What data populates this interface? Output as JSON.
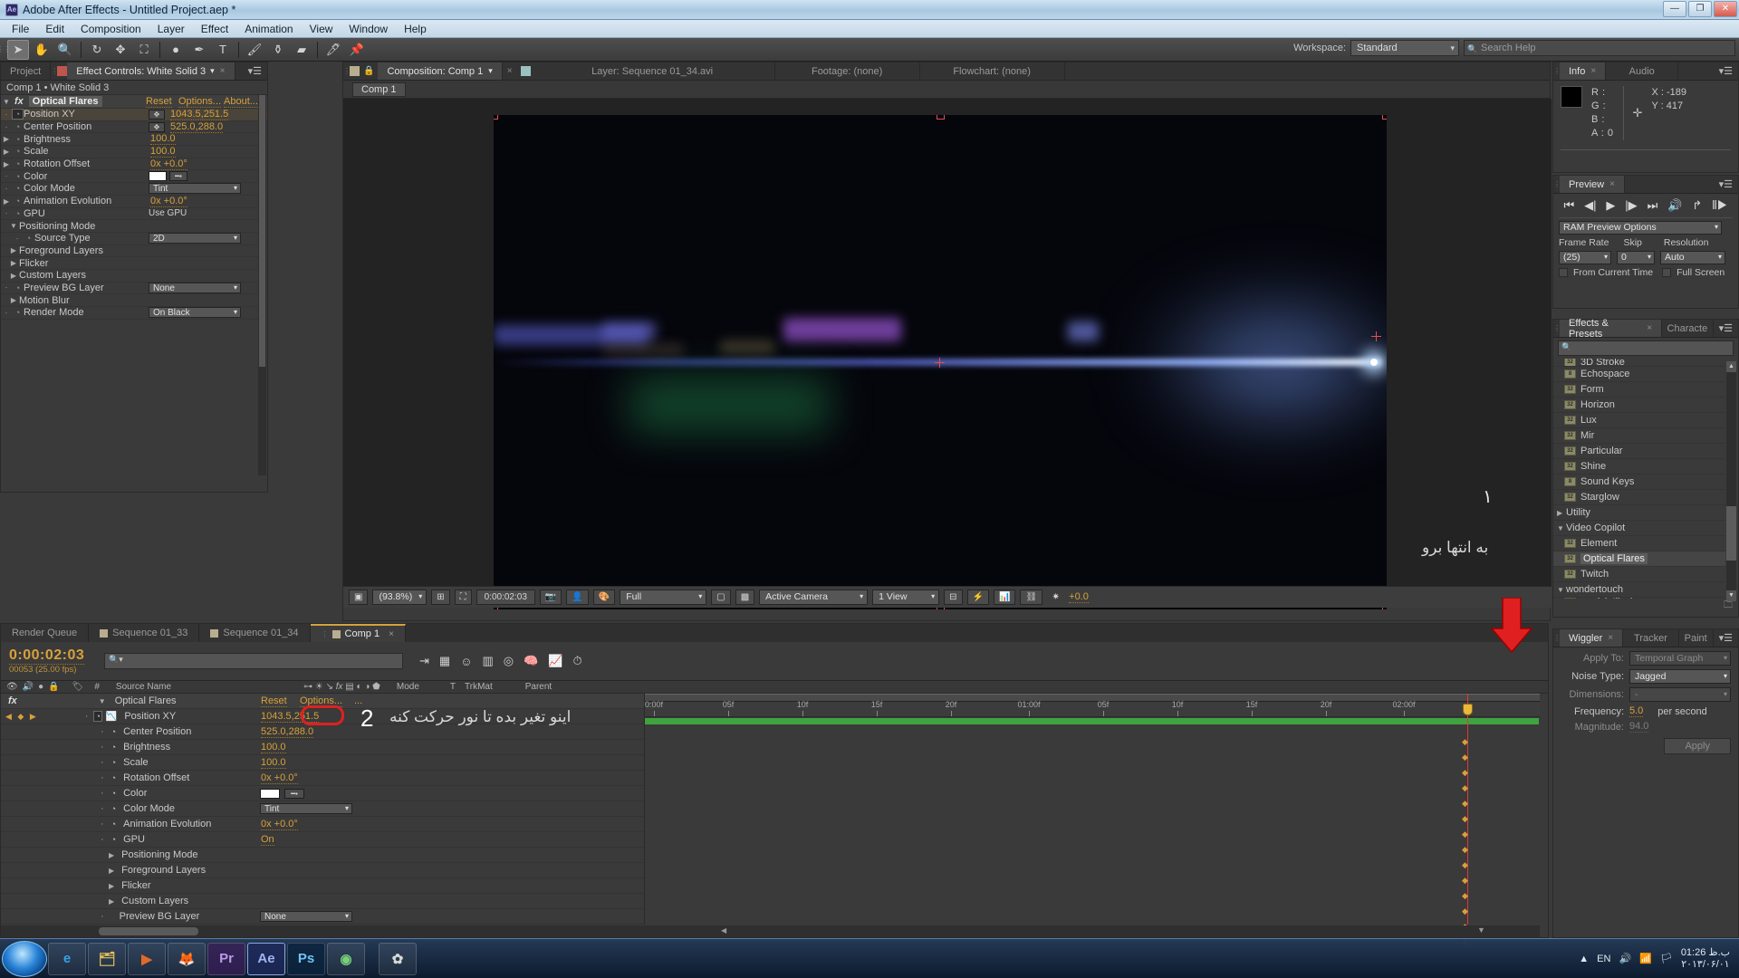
{
  "window": {
    "title": "Adobe After Effects - Untitled Project.aep *",
    "logo": "Ae",
    "minimize": "—",
    "maximize": "❐",
    "close": "✕"
  },
  "menu": [
    "File",
    "Edit",
    "Composition",
    "Layer",
    "Effect",
    "Animation",
    "View",
    "Window",
    "Help"
  ],
  "toolbar": {
    "tools": [
      {
        "name": "selection-tool",
        "glyph": "➤",
        "selected": true
      },
      {
        "name": "hand-tool",
        "glyph": "✋",
        "selected": false
      },
      {
        "name": "zoom-tool",
        "glyph": "🔍",
        "selected": false
      },
      {
        "name": "rotation-tool",
        "glyph": "↻",
        "selected": false
      },
      {
        "name": "unified-camera-tool",
        "glyph": "✥",
        "selected": false
      },
      {
        "name": "pan-behind-tool",
        "glyph": "⛶",
        "selected": false
      },
      {
        "name": "shape-tool",
        "glyph": "●",
        "selected": false
      },
      {
        "name": "pen-tool",
        "glyph": "✒",
        "selected": false
      },
      {
        "name": "type-tool",
        "glyph": "T",
        "selected": false
      },
      {
        "name": "brush-tool",
        "glyph": "🖌",
        "selected": false
      },
      {
        "name": "clone-stamp-tool",
        "glyph": "⚱",
        "selected": false
      },
      {
        "name": "eraser-tool",
        "glyph": "▰",
        "selected": false
      },
      {
        "name": "roto-brush-tool",
        "glyph": "🖊",
        "selected": false
      },
      {
        "name": "puppet-pin-tool",
        "glyph": "📌",
        "selected": false
      }
    ],
    "workspace_label": "Workspace:",
    "workspace_value": "Standard",
    "search_help_placeholder": "Search Help"
  },
  "effect_controls": {
    "tabs": [
      {
        "label": "Project",
        "active": false
      },
      {
        "label": "Effect Controls: White Solid 3",
        "active": true
      }
    ],
    "subheader": "Comp 1 • White Solid 3",
    "effect_name": "Optical Flares",
    "fx_badge": "fx",
    "reset_label": "Reset",
    "options_label": "Options...",
    "about_label": "About...",
    "properties": [
      {
        "name": "Position XY",
        "value": "1043.5,251.5",
        "type": "picker",
        "highlight": true
      },
      {
        "name": "Center Position",
        "value": "525.0,288.0",
        "type": "picker",
        "highlight": false
      },
      {
        "name": "Brightness",
        "value": "100.0",
        "type": "number",
        "twirl": true
      },
      {
        "name": "Scale",
        "value": "100.0",
        "type": "number",
        "twirl": true
      },
      {
        "name": "Rotation Offset",
        "value": "0x +0.0°",
        "type": "number",
        "twirl": true
      },
      {
        "name": "Color",
        "value": "",
        "type": "color"
      },
      {
        "name": "Color Mode",
        "value": "Tint",
        "type": "dropdown"
      },
      {
        "name": "Animation Evolution",
        "value": "0x +0.0°",
        "type": "number",
        "twirl": true
      },
      {
        "name": "GPU",
        "value": "Use GPU",
        "type": "checkbox"
      },
      {
        "name": "Positioning Mode",
        "value": "",
        "type": "group-open"
      },
      {
        "name": "Source Type",
        "value": "2D",
        "type": "dropdown",
        "indent": true
      },
      {
        "name": "Foreground Layers",
        "value": "",
        "type": "group"
      },
      {
        "name": "Flicker",
        "value": "",
        "type": "group"
      },
      {
        "name": "Custom Layers",
        "value": "",
        "type": "group"
      },
      {
        "name": "Preview BG Layer",
        "value": "None",
        "type": "dropdown"
      },
      {
        "name": "Motion Blur",
        "value": "",
        "type": "group"
      },
      {
        "name": "Render Mode",
        "value": "On Black",
        "type": "dropdown"
      }
    ]
  },
  "viewer": {
    "tabs": [
      {
        "label": "Composition: Comp 1",
        "active": true
      },
      {
        "label": "Layer: Sequence 01_34.avi",
        "active": false
      },
      {
        "label": "Footage: (none)",
        "active": false
      },
      {
        "label": "Flowchart: (none)",
        "active": false
      }
    ],
    "comp_tab": "Comp 1",
    "bottom_bar": {
      "magnification": "(93.8%)",
      "timecode": "0:00:02:03",
      "resolution": "Full",
      "camera": "Active Camera",
      "views": "1 View",
      "exposure": "+0.0"
    }
  },
  "info_panel": {
    "tabs": [
      {
        "label": "Info",
        "active": true
      },
      {
        "label": "Audio",
        "active": false
      }
    ],
    "r_label": "R :",
    "g_label": "G :",
    "b_label": "B :",
    "a_label": "A : 0",
    "x_label": "X : -189",
    "y_label": "Y : 417"
  },
  "preview_panel": {
    "tabs": [
      {
        "label": "Preview",
        "active": true
      }
    ],
    "transport": [
      "⏮",
      "◀|",
      "▶",
      "|▶",
      "⏭",
      "🔊",
      "↱",
      "⦀▶"
    ],
    "ram_preview_options": "RAM Preview Options",
    "frame_rate_label": "Frame Rate",
    "frame_rate_value": "(25)",
    "skip_label": "Skip",
    "skip_value": "0",
    "resolution_label": "Resolution",
    "resolution_value": "Auto",
    "from_current_time": "From Current Time",
    "full_screen": "Full Screen"
  },
  "effects_presets": {
    "tabs": [
      {
        "label": "Effects & Presets",
        "active": true
      },
      {
        "label": "Characte",
        "active": false
      }
    ],
    "search_placeholder": "",
    "items": [
      {
        "label": "3D Stroke",
        "type": "effect",
        "clipped": true
      },
      {
        "label": "Echospace",
        "type": "effect"
      },
      {
        "label": "Form",
        "type": "effect"
      },
      {
        "label": "Horizon",
        "type": "effect"
      },
      {
        "label": "Lux",
        "type": "effect"
      },
      {
        "label": "Mir",
        "type": "effect"
      },
      {
        "label": "Particular",
        "type": "effect"
      },
      {
        "label": "Shine",
        "type": "effect"
      },
      {
        "label": "Sound Keys",
        "type": "effect"
      },
      {
        "label": "Starglow",
        "type": "effect"
      },
      {
        "label": "Utility",
        "type": "group-closed"
      },
      {
        "label": "Video Copilot",
        "type": "group-open"
      },
      {
        "label": "Element",
        "type": "effect"
      },
      {
        "label": "Optical Flares",
        "type": "effect",
        "selected": true
      },
      {
        "label": "Twitch",
        "type": "effect"
      },
      {
        "label": "wondertouch",
        "type": "group-open"
      },
      {
        "label": "particleIllusion",
        "type": "effect",
        "clipped": true
      }
    ]
  },
  "wiggler": {
    "tabs": [
      {
        "label": "Wiggler",
        "active": true
      },
      {
        "label": "Tracker",
        "active": false
      },
      {
        "label": "Paint",
        "active": false
      }
    ],
    "apply_to_label": "Apply To:",
    "apply_to_value": "Temporal Graph",
    "noise_type_label": "Noise Type:",
    "noise_type_value": "Jagged",
    "dimensions_label": "Dimensions:",
    "dimensions_value": "-",
    "frequency_label": "Frequency:",
    "frequency_value": "5.0",
    "frequency_units": "per second",
    "magnitude_label": "Magnitude:",
    "magnitude_value": "94.0",
    "apply_button": "Apply"
  },
  "timeline": {
    "tabs": [
      {
        "label": "Render Queue",
        "active": false,
        "swatch": false
      },
      {
        "label": "Sequence 01_33",
        "active": false,
        "swatch": true
      },
      {
        "label": "Sequence 01_34",
        "active": false,
        "swatch": true
      },
      {
        "label": "Comp 1",
        "active": true,
        "swatch": true
      }
    ],
    "timecode": "0:00:02:03",
    "frame_info": "00053 (25.00 fps)",
    "search_placeholder": "",
    "columns": [
      "#",
      "Source Name",
      "Mode",
      "T",
      "TrkMat",
      "Parent"
    ],
    "rows": [
      {
        "name": "Optical Flares",
        "type": "effect-header",
        "value": "",
        "reset": "Reset",
        "options": "Options...",
        "more": "..."
      },
      {
        "name": "Position XY",
        "type": "prop-key",
        "value": "1043.5,251.5",
        "highlighted_value": "251.5"
      },
      {
        "name": "Center Position",
        "type": "prop",
        "value": "525.0,288.0"
      },
      {
        "name": "Brightness",
        "type": "prop",
        "value": "100.0"
      },
      {
        "name": "Scale",
        "type": "prop",
        "value": "100.0"
      },
      {
        "name": "Rotation Offset",
        "type": "prop",
        "value": "0x +0.0°"
      },
      {
        "name": "Color",
        "type": "color",
        "value": ""
      },
      {
        "name": "Color Mode",
        "type": "dropdown",
        "value": "Tint"
      },
      {
        "name": "Animation Evolution",
        "type": "prop",
        "value": "0x +0.0°"
      },
      {
        "name": "GPU",
        "type": "prop",
        "value": "On"
      },
      {
        "name": "Positioning Mode",
        "type": "group",
        "value": ""
      },
      {
        "name": "Foreground Layers",
        "type": "group",
        "value": ""
      },
      {
        "name": "Flicker",
        "type": "group",
        "value": ""
      },
      {
        "name": "Custom Layers",
        "type": "group",
        "value": ""
      },
      {
        "name": "Preview BG Layer",
        "type": "dropdown",
        "value": "None"
      }
    ],
    "ruler_ticks": [
      {
        "label": "0:00f",
        "pos": 0
      },
      {
        "label": "05f",
        "pos": 66
      },
      {
        "label": "10f",
        "pos": 132
      },
      {
        "label": "15f",
        "pos": 198
      },
      {
        "label": "20f",
        "pos": 264
      },
      {
        "label": "01:00f",
        "pos": 330
      },
      {
        "label": "05f",
        "pos": 396
      },
      {
        "label": "10f",
        "pos": 462
      },
      {
        "label": "15f",
        "pos": 528
      },
      {
        "label": "20f",
        "pos": 594
      },
      {
        "label": "02:00f",
        "pos": 660
      }
    ]
  },
  "annotations": {
    "note_one": "۱",
    "note_one_text": "به انتها برو",
    "note_two": "2",
    "note_two_text": "اینو تغیر بده تا نور حرکت کنه"
  },
  "taskbar": {
    "apps": [
      {
        "name": "internet-explorer",
        "glyph": "e",
        "color": "#2f7fd0"
      },
      {
        "name": "windows-explorer",
        "glyph": "🗂",
        "color": "#e3c05a"
      },
      {
        "name": "media-player",
        "glyph": "▶",
        "color": "#e06a2a"
      },
      {
        "name": "firefox",
        "glyph": "🦊",
        "color": "#e06a2a"
      },
      {
        "name": "adobe-premiere",
        "glyph": "Pr",
        "color": "#9b6fd0"
      },
      {
        "name": "adobe-after-effects",
        "glyph": "Ae",
        "color": "#7c8fe0"
      },
      {
        "name": "adobe-photoshop",
        "glyph": "Ps",
        "color": "#4aa8e0"
      },
      {
        "name": "chrome",
        "glyph": "◉",
        "color": "#4caf50"
      },
      {
        "name": "unknown-app",
        "glyph": "✿",
        "color": "#c0c0c0"
      }
    ],
    "language": "EN",
    "time": "01:26 ب.ظ",
    "date": "۲۰۱۳/۰۶/۰۱"
  },
  "colors": {
    "accent_orange": "#d8a13a",
    "red_annotation": "#e02020",
    "green_bar": "#3fa33f"
  }
}
